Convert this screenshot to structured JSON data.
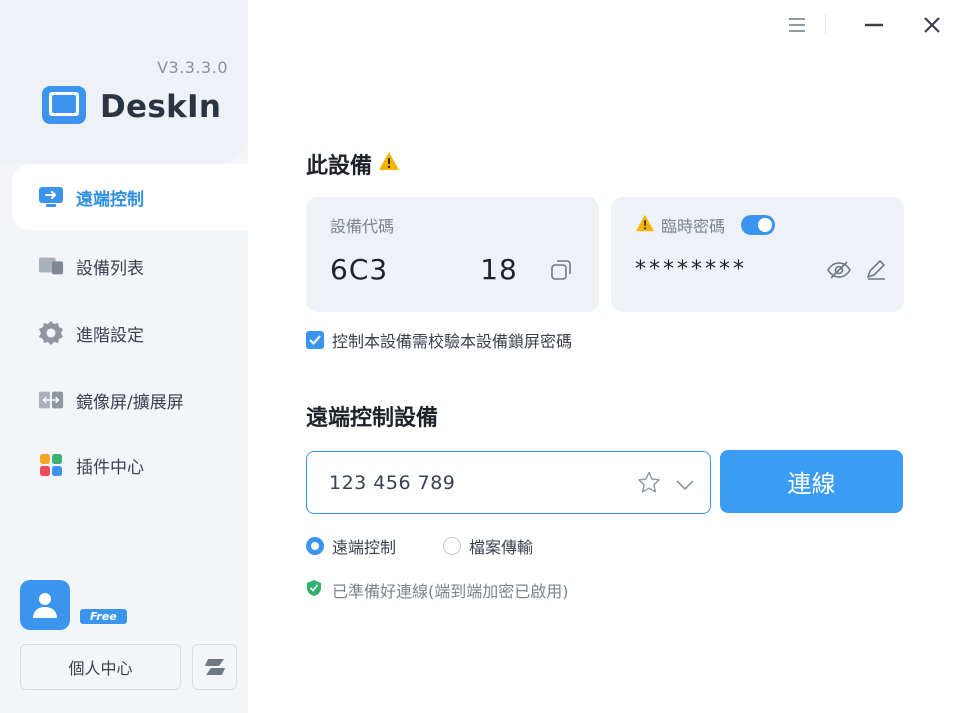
{
  "app": {
    "version": "V3.3.3.0",
    "logo_text": "DeskIn"
  },
  "sidebar": {
    "items": [
      {
        "label": "遠端控制",
        "icon": "remote-control-icon",
        "active": true
      },
      {
        "label": "設備列表",
        "icon": "device-list-icon",
        "active": false
      },
      {
        "label": "進階設定",
        "icon": "gear-icon",
        "active": false
      },
      {
        "label": "鏡像屏/擴展屏",
        "icon": "mirror-screen-icon",
        "active": false
      },
      {
        "label": "插件中心",
        "icon": "plugin-grid-icon",
        "active": false
      }
    ],
    "user": {
      "badge": "Free"
    },
    "profile_button": "個人中心"
  },
  "this_device": {
    "title": "此設備",
    "code_label": "設備代碼",
    "code_value": "6C3",
    "code_value_tail": "18",
    "temp_password_label": "臨時密碼",
    "temp_password_enabled": true,
    "password_masked": "********",
    "verify_checkbox_label": "控制本設備需校驗本設備鎖屏密碼",
    "verify_checked": true
  },
  "remote": {
    "title": "遠端控制設備",
    "input_value": "123 456 789",
    "connect_label": "連線",
    "modes": [
      {
        "label": "遠端控制",
        "selected": true
      },
      {
        "label": "檔案傳輸",
        "selected": false
      }
    ],
    "status": "已準備好連線(端到端加密已啟用)"
  },
  "colors": {
    "accent": "#3b95ee",
    "warning": "#f5b400",
    "status_green": "#2fb26b"
  }
}
